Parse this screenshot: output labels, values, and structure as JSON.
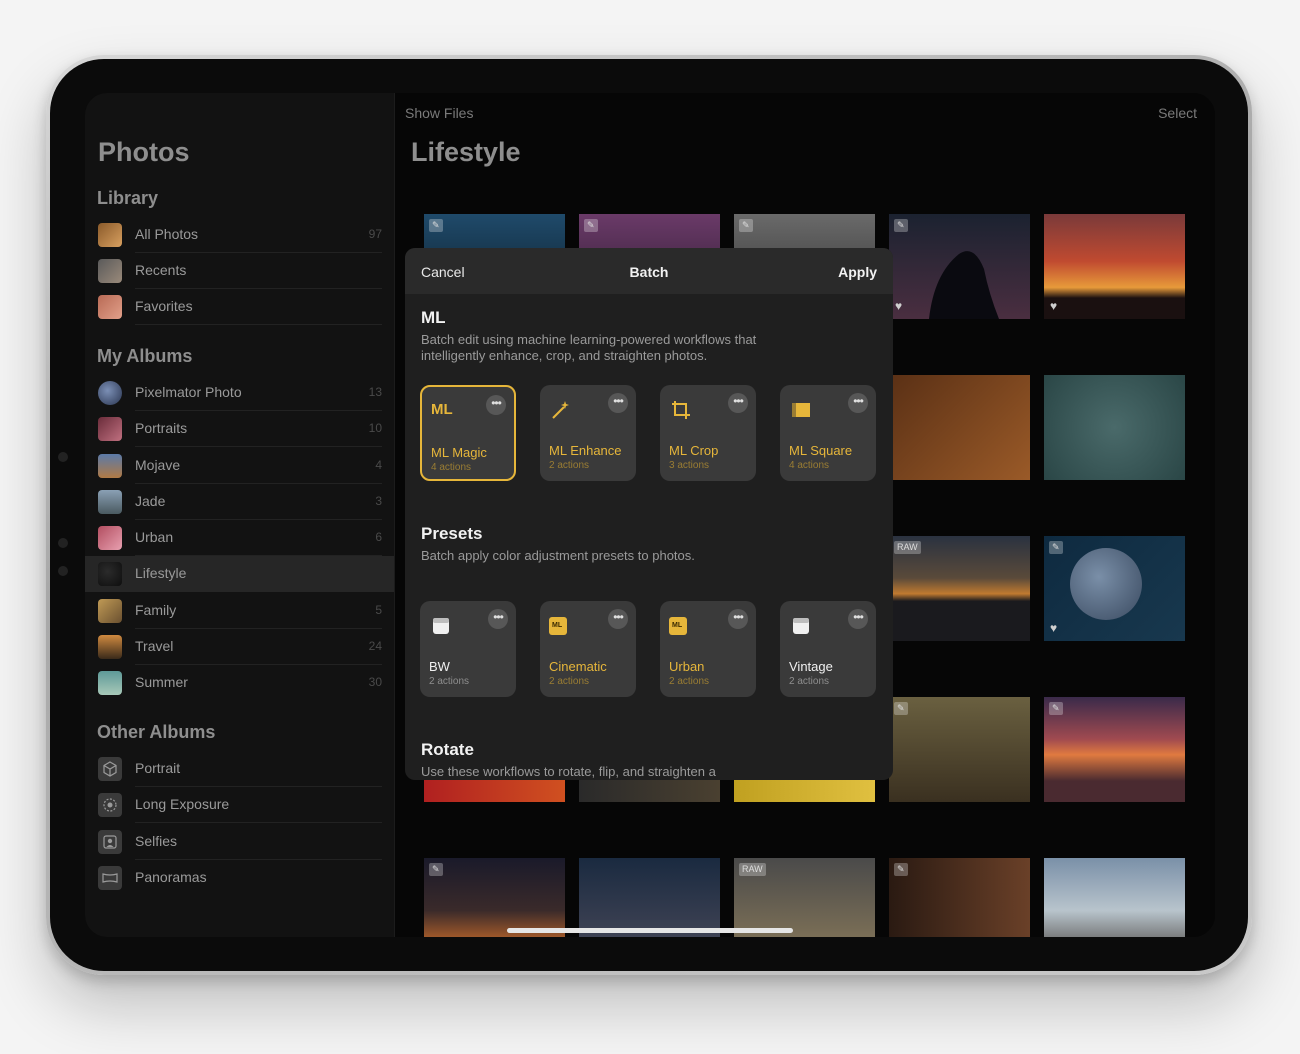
{
  "sidebar": {
    "title": "Photos",
    "library": {
      "heading": "Library",
      "items": [
        {
          "label": "All Photos",
          "count": "97"
        },
        {
          "label": "Recents",
          "count": ""
        },
        {
          "label": "Favorites",
          "count": ""
        }
      ]
    },
    "my_albums": {
      "heading": "My Albums",
      "items": [
        {
          "label": "Pixelmator Photo",
          "count": "13"
        },
        {
          "label": "Portraits",
          "count": "10"
        },
        {
          "label": "Mojave",
          "count": "4"
        },
        {
          "label": "Jade",
          "count": "3"
        },
        {
          "label": "Urban",
          "count": "6"
        },
        {
          "label": "Lifestyle",
          "count": ""
        },
        {
          "label": "Family",
          "count": "5"
        },
        {
          "label": "Travel",
          "count": "24"
        },
        {
          "label": "Summer",
          "count": "30"
        }
      ]
    },
    "other_albums": {
      "heading": "Other Albums",
      "items": [
        {
          "label": "Portrait"
        },
        {
          "label": "Long Exposure"
        },
        {
          "label": "Selfies"
        },
        {
          "label": "Panoramas"
        }
      ]
    }
  },
  "main": {
    "show_files": "Show Files",
    "select": "Select",
    "title": "Lifestyle",
    "badge_raw": "RAW"
  },
  "sheet": {
    "cancel": "Cancel",
    "title": "Batch",
    "apply": "Apply",
    "ml": {
      "heading": "ML",
      "description": "Batch edit using machine learning-powered workflows that intelligently enhance, crop, and straighten photos.",
      "cards": [
        {
          "name": "ML Magic",
          "actions": "4 actions",
          "icon_text": "ML"
        },
        {
          "name": "ML Enhance",
          "actions": "2 actions"
        },
        {
          "name": "ML Crop",
          "actions": "3 actions"
        },
        {
          "name": "ML Square",
          "actions": "4 actions"
        }
      ]
    },
    "presets": {
      "heading": "Presets",
      "description": "Batch apply color adjustment presets to photos.",
      "cards": [
        {
          "name": "BW",
          "actions": "2 actions"
        },
        {
          "name": "Cinematic",
          "actions": "2 actions",
          "icon_text": "ML"
        },
        {
          "name": "Urban",
          "actions": "2 actions",
          "icon_text": "ML"
        },
        {
          "name": "Vintage",
          "actions": "2 actions"
        }
      ]
    },
    "rotate": {
      "heading": "Rotate",
      "description": "Use these workflows to rotate, flip, and straighten a"
    },
    "more_glyph": "•••"
  },
  "colors": {
    "accent": "#e6b63a",
    "sheet_bg": "#1f1f1f",
    "card_bg": "#3a3a3a"
  }
}
